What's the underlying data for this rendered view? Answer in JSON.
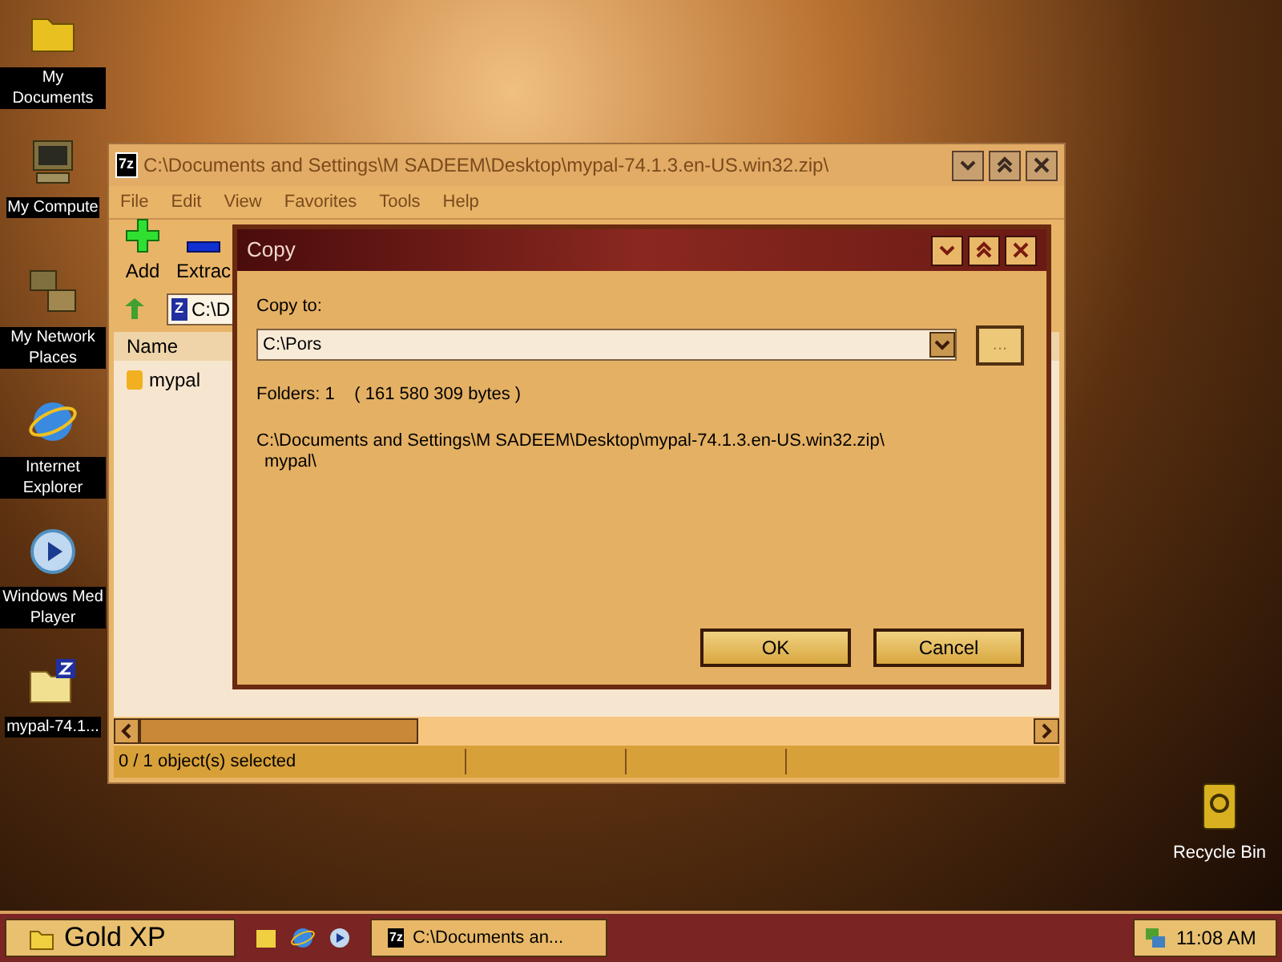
{
  "desktop_icons": [
    {
      "kind": "documents",
      "label": "My Documents"
    },
    {
      "kind": "computer",
      "label": "My Compute"
    },
    {
      "kind": "network",
      "label": "My Network Places"
    },
    {
      "kind": "browser",
      "label": "Internet Explorer"
    },
    {
      "kind": "media",
      "label": "Windows Med Player"
    },
    {
      "kind": "archive",
      "label": "mypal-74.1..."
    }
  ],
  "recycle_bin": {
    "label": "Recycle Bin"
  },
  "main_window": {
    "logo": "7z",
    "title": "C:\\Documents and Settings\\M SADEEM\\Desktop\\mypal-74.1.3.en-US.win32.zip\\",
    "active": false,
    "menu": [
      "File",
      "Edit",
      "View",
      "Favorites",
      "Tools",
      "Help"
    ],
    "toolbar": [
      {
        "kind": "add",
        "label": "Add"
      },
      {
        "kind": "extract",
        "label": "Extrac"
      }
    ],
    "address_badge": "Z",
    "address": "C:\\D",
    "columns": [
      "Name"
    ],
    "rows": [
      {
        "name": "mypal",
        "selected": false
      }
    ],
    "status_bar": [
      "0 / 1 object(s) selected"
    ]
  },
  "dialog": {
    "title": "Copy",
    "active": true,
    "copy_to_label": "Copy to:",
    "copy_to_value": "C:\\Pors",
    "browse_button": "...",
    "summary": "Folders: 1    ( 161 580 309 bytes )",
    "path_lines": [
      "C:\\Documents and Settings\\M SADEEM\\Desktop\\mypal-74.1.3.en-US.win32.zip\\",
      "mypal\\"
    ],
    "buttons": [
      "OK",
      "Cancel"
    ]
  },
  "taskbar": {
    "start": "Gold XP",
    "tasks": [
      {
        "logo": "7z",
        "label": "C:\\Documents an...",
        "selected": false
      }
    ],
    "clock": "11:08 AM"
  }
}
